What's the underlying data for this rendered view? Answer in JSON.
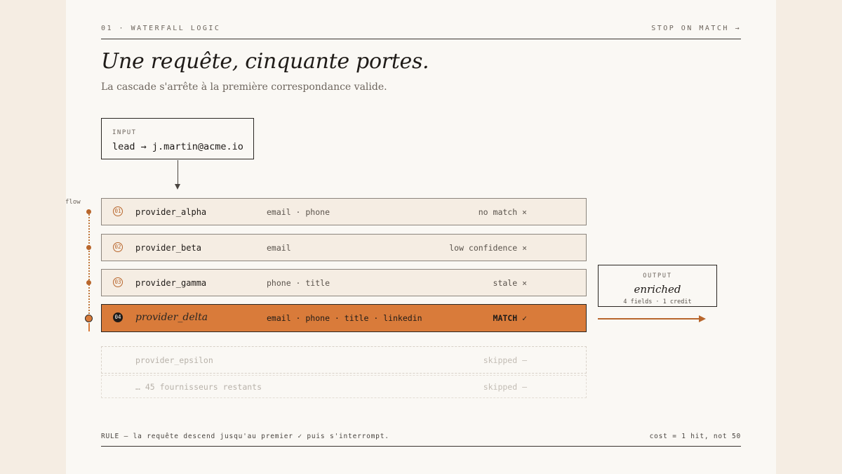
{
  "header": {
    "section": "01 · WATERFALL LOGIC",
    "tagline": "STOP ON MATCH →"
  },
  "title": "Une requête, cinquante portes.",
  "subtitle": "La cascade s'arrête à la première correspondance valide.",
  "input": {
    "label": "INPUT",
    "value": "lead → j.martin@acme.io"
  },
  "flow_label": "flow",
  "providers": [
    {
      "num": "01",
      "name": "provider_alpha",
      "fields": "email · phone",
      "status": "no match ×",
      "state": "miss"
    },
    {
      "num": "02",
      "name": "provider_beta",
      "fields": "email",
      "status": "low confidence ×",
      "state": "miss"
    },
    {
      "num": "03",
      "name": "provider_gamma",
      "fields": "phone · title",
      "status": "stale ×",
      "state": "miss"
    },
    {
      "num": "04",
      "name": "provider_delta",
      "fields": "email · phone · title · linkedin",
      "status": "MATCH ✓",
      "state": "match"
    },
    {
      "num": "",
      "name": "provider_epsilon",
      "fields": "",
      "status": "skipped —",
      "state": "skipped"
    },
    {
      "num": "",
      "name": "… 45 fournisseurs restants",
      "fields": "",
      "status": "skipped —",
      "state": "skipped"
    }
  ],
  "output": {
    "label": "OUTPUT",
    "title": "enriched",
    "sub": "4 fields · 1 credit"
  },
  "footer": {
    "rule": "RULE — la requête descend jusqu'au premier ✓ puis s'interrompt.",
    "cost": "cost = 1 hit, not 50"
  },
  "colors": {
    "accent": "#d97b3a",
    "accent_dark": "#b8662c",
    "ink": "#2a2622",
    "paper": "#faf8f4",
    "row_bg": "#f5ede3"
  }
}
